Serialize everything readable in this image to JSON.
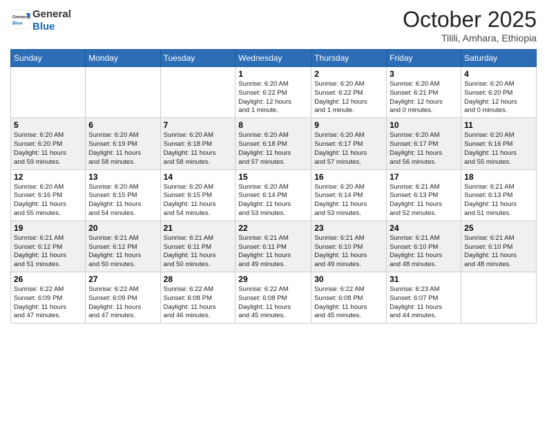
{
  "header": {
    "logo_general": "General",
    "logo_blue": "Blue",
    "title": "October 2025",
    "subtitle": "Tilili, Amhara, Ethiopia"
  },
  "calendar": {
    "weekdays": [
      "Sunday",
      "Monday",
      "Tuesday",
      "Wednesday",
      "Thursday",
      "Friday",
      "Saturday"
    ],
    "weeks": [
      [
        {
          "day": "",
          "info": ""
        },
        {
          "day": "",
          "info": ""
        },
        {
          "day": "",
          "info": ""
        },
        {
          "day": "1",
          "info": "Sunrise: 6:20 AM\nSunset: 6:22 PM\nDaylight: 12 hours\nand 1 minute."
        },
        {
          "day": "2",
          "info": "Sunrise: 6:20 AM\nSunset: 6:22 PM\nDaylight: 12 hours\nand 1 minute."
        },
        {
          "day": "3",
          "info": "Sunrise: 6:20 AM\nSunset: 6:21 PM\nDaylight: 12 hours\nand 0 minutes."
        },
        {
          "day": "4",
          "info": "Sunrise: 6:20 AM\nSunset: 6:20 PM\nDaylight: 12 hours\nand 0 minutes."
        }
      ],
      [
        {
          "day": "5",
          "info": "Sunrise: 6:20 AM\nSunset: 6:20 PM\nDaylight: 11 hours\nand 59 minutes."
        },
        {
          "day": "6",
          "info": "Sunrise: 6:20 AM\nSunset: 6:19 PM\nDaylight: 11 hours\nand 58 minutes."
        },
        {
          "day": "7",
          "info": "Sunrise: 6:20 AM\nSunset: 6:18 PM\nDaylight: 11 hours\nand 58 minutes."
        },
        {
          "day": "8",
          "info": "Sunrise: 6:20 AM\nSunset: 6:18 PM\nDaylight: 11 hours\nand 57 minutes."
        },
        {
          "day": "9",
          "info": "Sunrise: 6:20 AM\nSunset: 6:17 PM\nDaylight: 11 hours\nand 57 minutes."
        },
        {
          "day": "10",
          "info": "Sunrise: 6:20 AM\nSunset: 6:17 PM\nDaylight: 11 hours\nand 56 minutes."
        },
        {
          "day": "11",
          "info": "Sunrise: 6:20 AM\nSunset: 6:16 PM\nDaylight: 11 hours\nand 55 minutes."
        }
      ],
      [
        {
          "day": "12",
          "info": "Sunrise: 6:20 AM\nSunset: 6:16 PM\nDaylight: 11 hours\nand 55 minutes."
        },
        {
          "day": "13",
          "info": "Sunrise: 6:20 AM\nSunset: 6:15 PM\nDaylight: 11 hours\nand 54 minutes."
        },
        {
          "day": "14",
          "info": "Sunrise: 6:20 AM\nSunset: 6:15 PM\nDaylight: 11 hours\nand 54 minutes."
        },
        {
          "day": "15",
          "info": "Sunrise: 6:20 AM\nSunset: 6:14 PM\nDaylight: 11 hours\nand 53 minutes."
        },
        {
          "day": "16",
          "info": "Sunrise: 6:20 AM\nSunset: 6:14 PM\nDaylight: 11 hours\nand 53 minutes."
        },
        {
          "day": "17",
          "info": "Sunrise: 6:21 AM\nSunset: 6:13 PM\nDaylight: 11 hours\nand 52 minutes."
        },
        {
          "day": "18",
          "info": "Sunrise: 6:21 AM\nSunset: 6:13 PM\nDaylight: 11 hours\nand 51 minutes."
        }
      ],
      [
        {
          "day": "19",
          "info": "Sunrise: 6:21 AM\nSunset: 6:12 PM\nDaylight: 11 hours\nand 51 minutes."
        },
        {
          "day": "20",
          "info": "Sunrise: 6:21 AM\nSunset: 6:12 PM\nDaylight: 11 hours\nand 50 minutes."
        },
        {
          "day": "21",
          "info": "Sunrise: 6:21 AM\nSunset: 6:11 PM\nDaylight: 11 hours\nand 50 minutes."
        },
        {
          "day": "22",
          "info": "Sunrise: 6:21 AM\nSunset: 6:11 PM\nDaylight: 11 hours\nand 49 minutes."
        },
        {
          "day": "23",
          "info": "Sunrise: 6:21 AM\nSunset: 6:10 PM\nDaylight: 11 hours\nand 49 minutes."
        },
        {
          "day": "24",
          "info": "Sunrise: 6:21 AM\nSunset: 6:10 PM\nDaylight: 11 hours\nand 48 minutes."
        },
        {
          "day": "25",
          "info": "Sunrise: 6:21 AM\nSunset: 6:10 PM\nDaylight: 11 hours\nand 48 minutes."
        }
      ],
      [
        {
          "day": "26",
          "info": "Sunrise: 6:22 AM\nSunset: 6:09 PM\nDaylight: 11 hours\nand 47 minutes."
        },
        {
          "day": "27",
          "info": "Sunrise: 6:22 AM\nSunset: 6:09 PM\nDaylight: 11 hours\nand 47 minutes."
        },
        {
          "day": "28",
          "info": "Sunrise: 6:22 AM\nSunset: 6:08 PM\nDaylight: 11 hours\nand 46 minutes."
        },
        {
          "day": "29",
          "info": "Sunrise: 6:22 AM\nSunset: 6:08 PM\nDaylight: 11 hours\nand 45 minutes."
        },
        {
          "day": "30",
          "info": "Sunrise: 6:22 AM\nSunset: 6:08 PM\nDaylight: 11 hours\nand 45 minutes."
        },
        {
          "day": "31",
          "info": "Sunrise: 6:23 AM\nSunset: 6:07 PM\nDaylight: 11 hours\nand 44 minutes."
        },
        {
          "day": "",
          "info": ""
        }
      ]
    ]
  }
}
